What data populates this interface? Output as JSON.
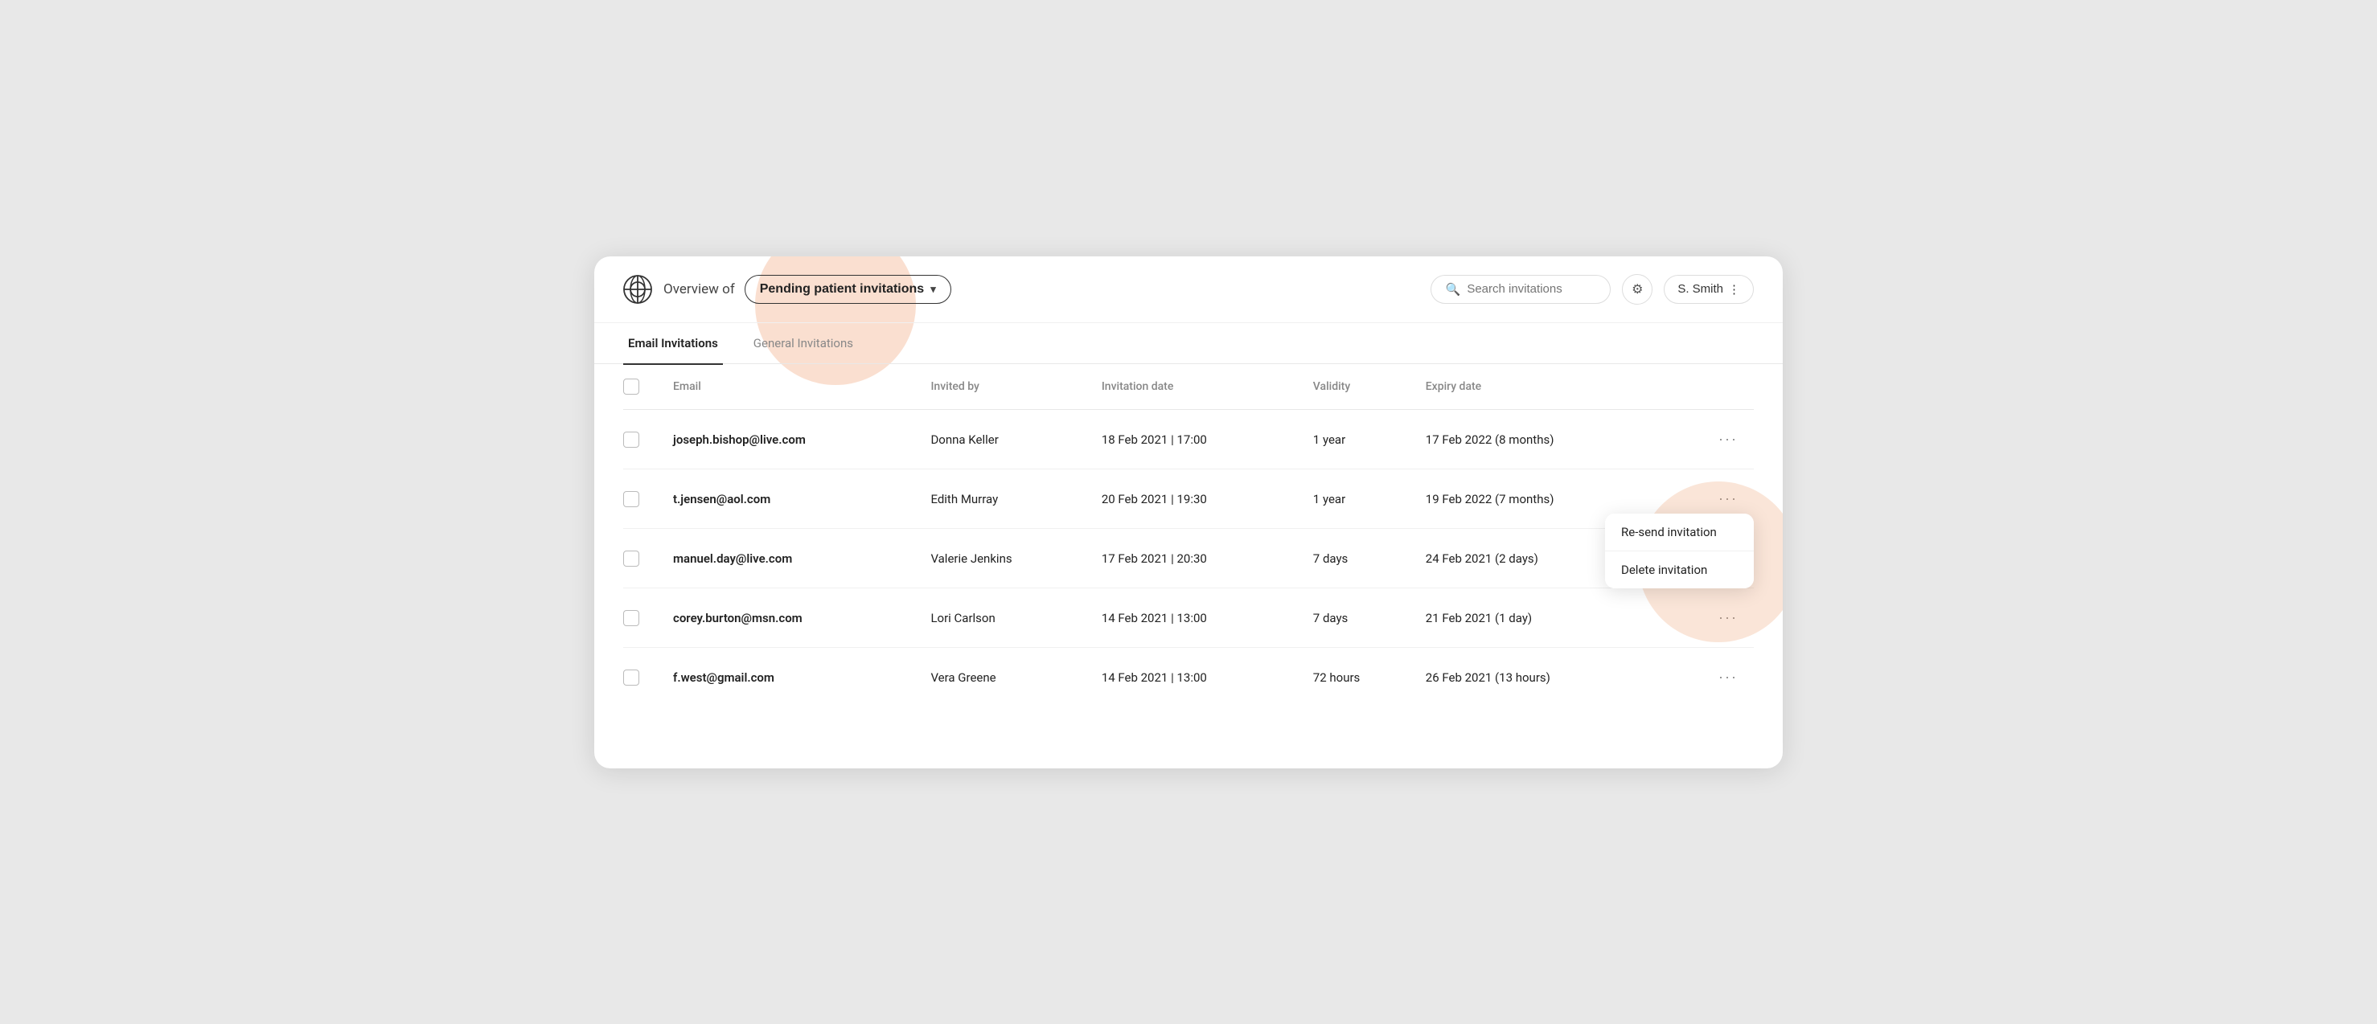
{
  "header": {
    "overview_label": "Overview of",
    "dropdown_label": "Pending patient invitations",
    "search_placeholder": "Search invitations",
    "filter_icon": "⚙",
    "user_name": "S. Smith",
    "user_more_icon": "⋮"
  },
  "tabs": [
    {
      "label": "Email Invitations",
      "active": true
    },
    {
      "label": "General Invitations",
      "active": false
    }
  ],
  "table": {
    "columns": [
      "",
      "Email",
      "Invited by",
      "Invitation date",
      "Validity",
      "Expiry date",
      ""
    ],
    "rows": [
      {
        "email": "joseph.bishop@live.com",
        "invited_by": "Donna Keller",
        "invitation_date": "18 Feb 2021 | 17:00",
        "validity": "1 year",
        "expiry_date": "17 Feb 2022 (8 months)"
      },
      {
        "email": "t.jensen@aol.com",
        "invited_by": "Edith Murray",
        "invitation_date": "20 Feb 2021 | 19:30",
        "validity": "1 year",
        "expiry_date": "19 Feb 2022 (7 months)"
      },
      {
        "email": "manuel.day@live.com",
        "invited_by": "Valerie Jenkins",
        "invitation_date": "17 Feb 2021 | 20:30",
        "validity": "7 days",
        "expiry_date": "24 Feb 2021 (2 days)"
      },
      {
        "email": "corey.burton@msn.com",
        "invited_by": "Lori Carlson",
        "invitation_date": "14 Feb 2021 | 13:00",
        "validity": "7 days",
        "expiry_date": "21 Feb 2021 (1 day)"
      },
      {
        "email": "f.west@gmail.com",
        "invited_by": "Vera Greene",
        "invitation_date": "14 Feb 2021 | 13:00",
        "validity": "72 hours",
        "expiry_date": "26 Feb 2021 (13 hours)"
      }
    ]
  },
  "context_menu": {
    "items": [
      "Re-send invitation",
      "Delete invitation"
    ]
  },
  "colors": {
    "active_tab_underline": "#333333",
    "deco_circle": "#ED9664"
  }
}
